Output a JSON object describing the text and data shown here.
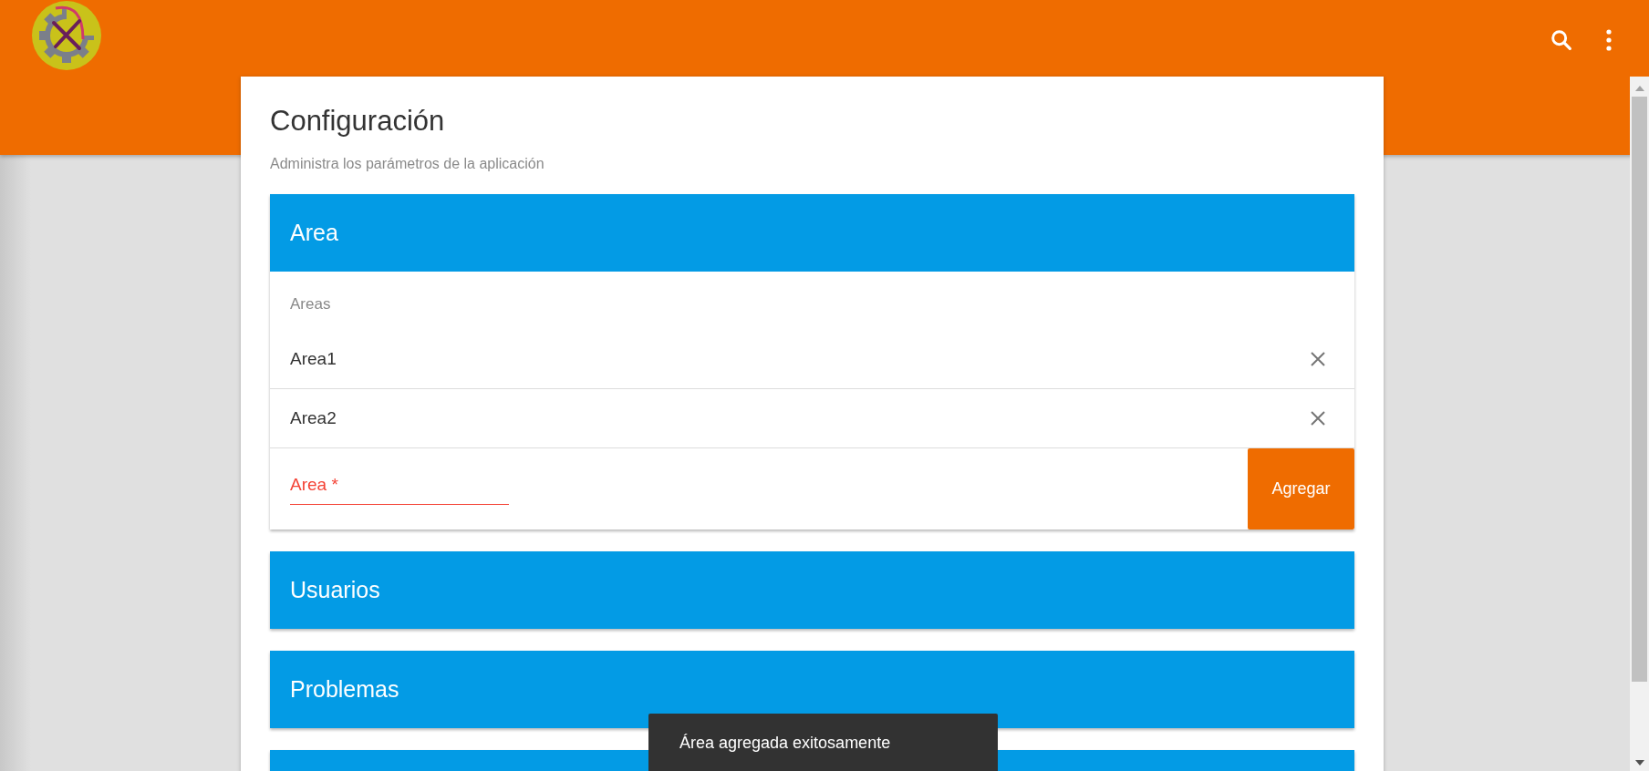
{
  "page": {
    "title": "Configuración",
    "subtitle": "Administra los parámetros de la aplicación"
  },
  "sections": [
    {
      "kind": "panel",
      "title": "Area",
      "list_label": "Areas",
      "items": [
        "Area1",
        "Area2"
      ],
      "field": {
        "placeholder": "Area *",
        "error": true
      },
      "button": "Agregar"
    },
    {
      "kind": "panel",
      "title": "Usuarios"
    },
    {
      "kind": "panel",
      "title": "Problemas"
    },
    {
      "kind": "panel"
    }
  ],
  "snackbar": {
    "message": "Área agregada exitosamente"
  }
}
